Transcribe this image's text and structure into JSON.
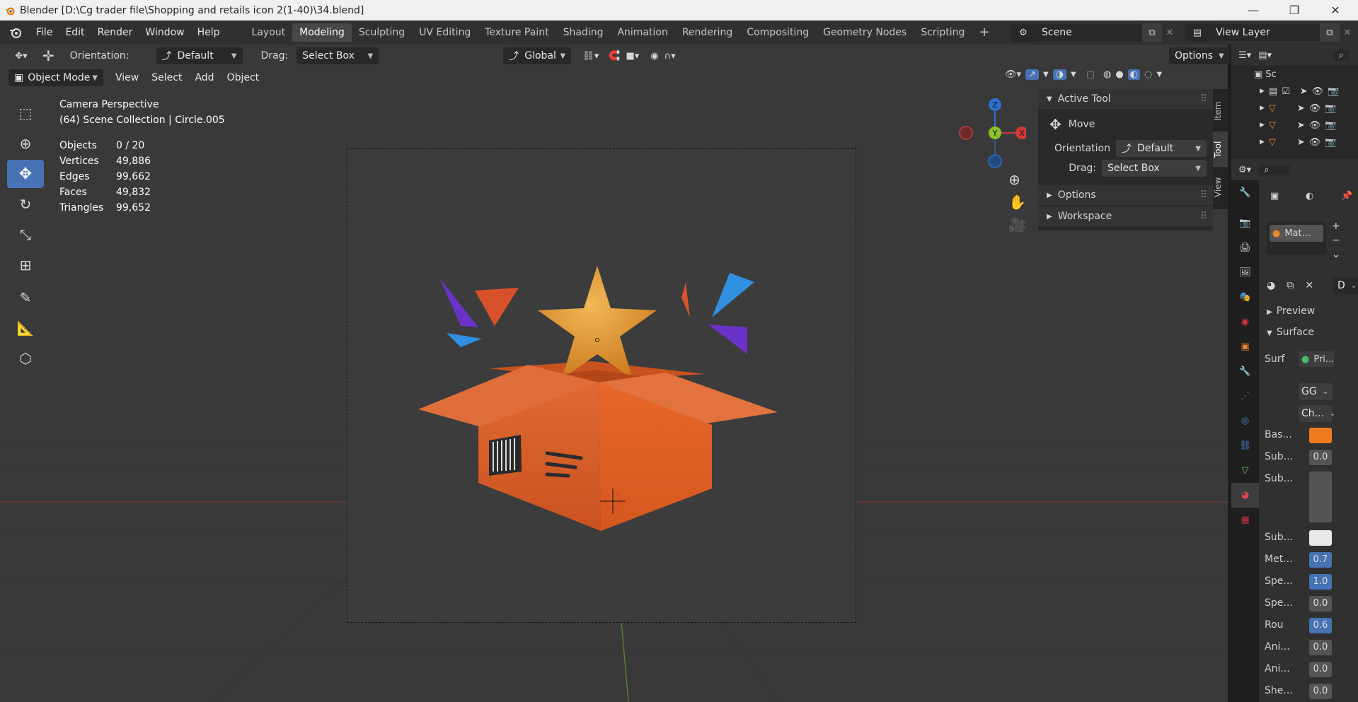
{
  "window": {
    "title": "Blender [D:\\Cg trader file\\Shopping and retails icon 2(1-40)\\34.blend]"
  },
  "menu": [
    "File",
    "Edit",
    "Render",
    "Window",
    "Help"
  ],
  "workspaces": [
    "Layout",
    "Modeling",
    "Sculpting",
    "UV Editing",
    "Texture Paint",
    "Shading",
    "Animation",
    "Rendering",
    "Compositing",
    "Geometry Nodes",
    "Scripting"
  ],
  "active_workspace": "Modeling",
  "scene": {
    "name": "Scene",
    "view_layer": "View Layer"
  },
  "tool_header": {
    "orientation_label": "Orientation:",
    "orientation_value": "Default",
    "drag_label": "Drag:",
    "drag_value": "Select Box",
    "transform_space": "Global",
    "options": "Options"
  },
  "viewport_header": {
    "mode": "Object Mode",
    "menus": [
      "View",
      "Select",
      "Add",
      "Object"
    ]
  },
  "overlay": {
    "camera": "Camera Perspective",
    "collection": "(64) Scene Collection | Circle.005",
    "stats": [
      {
        "label": "Objects",
        "value": "0 / 20"
      },
      {
        "label": "Vertices",
        "value": "49,886"
      },
      {
        "label": "Edges",
        "value": "99,662"
      },
      {
        "label": "Faces",
        "value": "49,832"
      },
      {
        "label": "Triangles",
        "value": "99,652"
      }
    ]
  },
  "gizmo": {
    "z": "Z",
    "y": "Y",
    "x": "X"
  },
  "npanel": {
    "active_tool_title": "Active Tool",
    "tool_name": "Move",
    "orientation_label": "Orientation",
    "orientation_value": "Default",
    "drag_label": "Drag:",
    "drag_value": "Select Box",
    "options": "Options",
    "workspace": "Workspace",
    "tabs": [
      "Item",
      "Tool",
      "View"
    ]
  },
  "outliner": {
    "root": "Sc"
  },
  "properties": {
    "material_slot": "Mat...",
    "material_output": "D",
    "preview": "Preview",
    "surface": "Surface",
    "surface_label": "Surf",
    "surface_value": "Pri...",
    "gg": "GG",
    "ch": "Ch...",
    "rows": [
      {
        "label": "Bas...",
        "value": ""
      },
      {
        "label": "Sub...",
        "value": "0.0"
      },
      {
        "label": "Sub...",
        "value": ""
      },
      {
        "label": "Sub...",
        "value": ""
      },
      {
        "label": "Met...",
        "value": "0.7"
      },
      {
        "label": "Spe...",
        "value": "1.0"
      },
      {
        "label": "Spe...",
        "value": "0.0"
      },
      {
        "label": "Rou",
        "value": "0.6"
      },
      {
        "label": "Ani...",
        "value": "0.0"
      },
      {
        "label": "Ani...",
        "value": "0.0"
      },
      {
        "label": "She...",
        "value": "0.0"
      }
    ]
  },
  "colors": {
    "accent": "#4772b3",
    "box_orange": "#e0622a",
    "star": "#e8962e",
    "base_color": "#f07a1e"
  }
}
